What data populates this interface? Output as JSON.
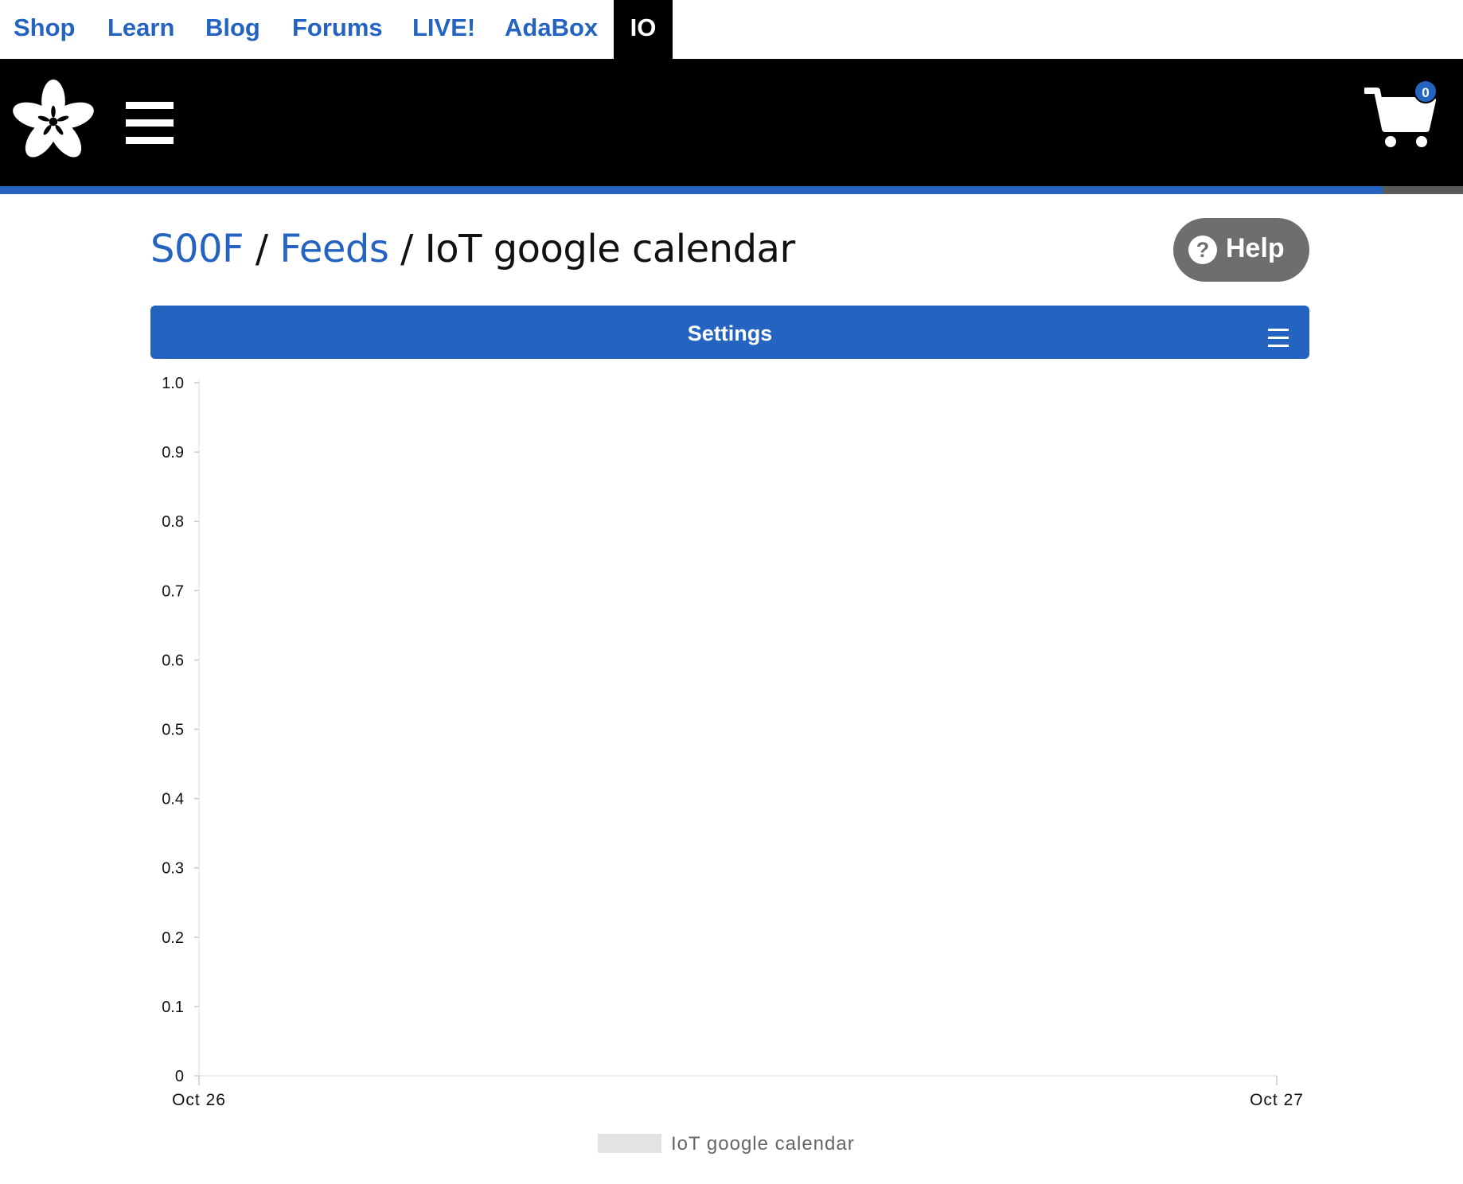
{
  "topnav": {
    "links": [
      {
        "label": "Shop"
      },
      {
        "label": "Learn"
      },
      {
        "label": "Blog"
      },
      {
        "label": "Forums"
      },
      {
        "label": "LIVE!"
      },
      {
        "label": "AdaBox"
      },
      {
        "label": "IO",
        "active": true
      }
    ]
  },
  "header": {
    "logo_icon": "adafruit-flower-logo",
    "menu_icon": "hamburger-icon",
    "cart_icon": "cart-icon",
    "cart_count": "0"
  },
  "progress": {
    "fraction": 0.945
  },
  "breadcrumb": {
    "user": "S00F",
    "separator": "/",
    "feeds": "Feeds",
    "current": "IoT google calendar"
  },
  "help": {
    "label": "Help",
    "icon": "question-circle-icon"
  },
  "settings": {
    "label": "Settings",
    "menu_icon": "hamburger-icon"
  },
  "colors": {
    "accent": "#2563c0",
    "header_bg": "#000000",
    "help_bg": "#6e6e6e"
  },
  "chart_data": {
    "type": "line",
    "title": "",
    "xlabel": "",
    "ylabel": "",
    "ylim": [
      0,
      1
    ],
    "yticks": [
      "0",
      "0.1",
      "0.2",
      "0.3",
      "0.4",
      "0.5",
      "0.6",
      "0.7",
      "0.8",
      "0.9",
      "1.0"
    ],
    "xticks": [
      "Oct 26",
      "Oct 27"
    ],
    "series": [
      {
        "name": "IoT google calendar",
        "values": [],
        "color": "#e3e3e3"
      }
    ],
    "grid": false,
    "legend": "bottom-center"
  }
}
